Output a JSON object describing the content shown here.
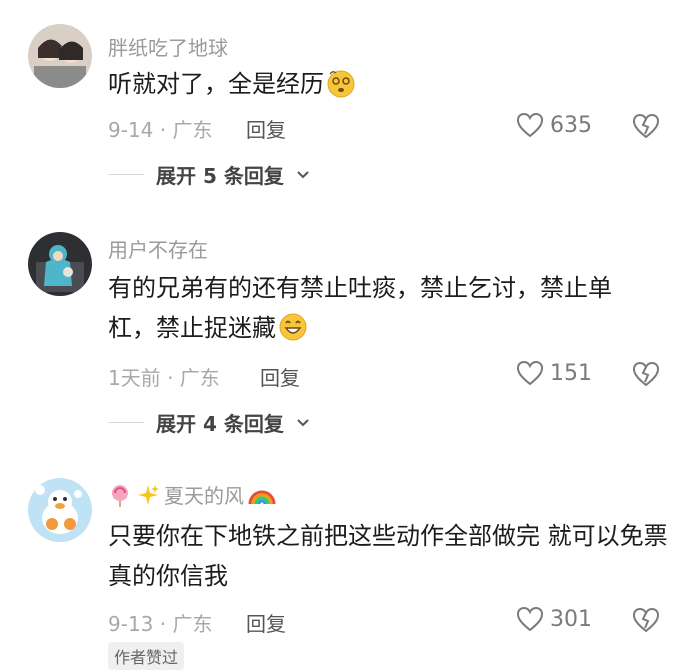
{
  "comments": [
    {
      "username": "胖纸吃了地球",
      "text": "听就对了，全是经历",
      "text_emoji": "fainting-face-emoji",
      "date_location": "9-14 · 广东",
      "reply_label": "回复",
      "likes": "635",
      "expand_label": "展开 5 条回复"
    },
    {
      "username": "用户不存在",
      "text": "有的兄弟有的还有禁止吐痰，禁止乞讨，禁止单杠，禁止捉迷藏",
      "text_emoji": "grinning-face-emoji",
      "date_location": "1天前 · 广东",
      "reply_label": "回复",
      "likes": "151",
      "expand_label": "展开 4 条回复"
    },
    {
      "username_prefix_icons": [
        "lollipop-icon",
        "sparkles-icon"
      ],
      "username": "夏天的风",
      "username_suffix_icon": "rainbow-icon",
      "text": "只要你在下地铁之前把这些动作全部做完 就可以免票 真的你信我",
      "date_location": "9-13 · 广东",
      "reply_label": "回复",
      "likes": "301",
      "badge": "作者赞过"
    }
  ],
  "colors": {
    "username": "#9a9a9a",
    "text": "#1c1c1c",
    "meta": "#a8a8a8",
    "like_icon": "#7a7a7a"
  }
}
